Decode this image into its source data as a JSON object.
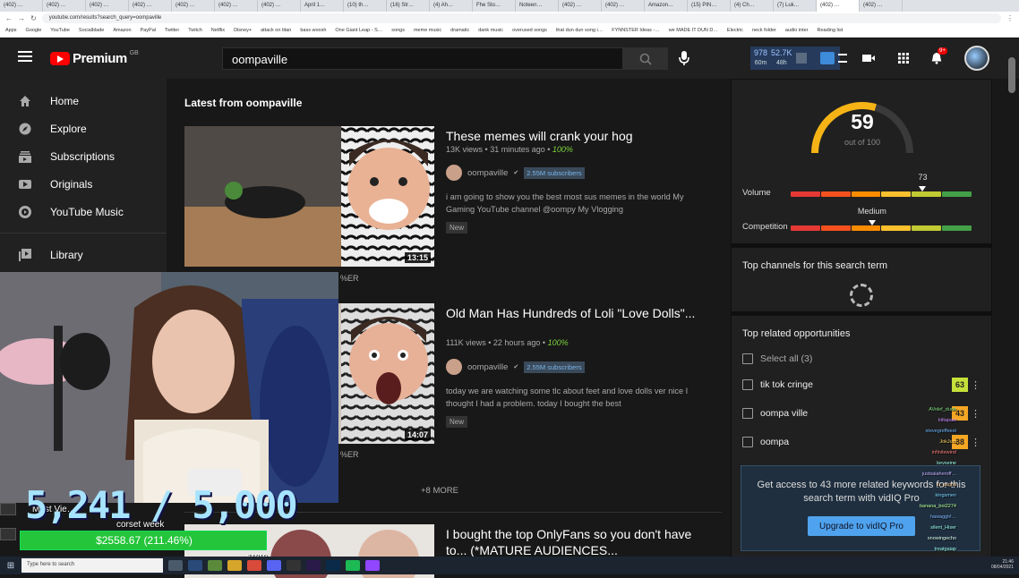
{
  "browser": {
    "tabs": [
      "(402) …",
      "(402) …",
      "(402) …",
      "(402) …",
      "(402) …",
      "(402) …",
      "(402) …",
      "April 1…",
      "(10) th…",
      "(16) Str…",
      "(4) Ah…",
      "Fhe Sto…",
      "Noteen…",
      "(402) …",
      "(402) …",
      "Amazon…",
      "(15) PIN…",
      "(4) Ch…",
      "(7) Luk…",
      "(402) …",
      "(402) …"
    ],
    "url": "youtube.com/results?search_query=oompaville",
    "bookmarks": [
      "Apps",
      "Google",
      "YouTube",
      "Socialblade",
      "Amazon",
      "PayPal",
      "Twitter",
      "Twitch",
      "Netflix",
      "Disney+",
      "attack on titan",
      "bass woosh",
      "One Giant Leap - S…",
      "songs",
      "meme music",
      "dramatic",
      "dank music",
      "overused songs",
      "that dun dun song i…",
      "FYNNSTER Ideas -…",
      "we MADE IT DUN D…",
      "Electric",
      "neck folder",
      "audio inter",
      "Reading list"
    ]
  },
  "header": {
    "logo_text": "Premium",
    "logo_sup": "GB",
    "search_value": "oompaville",
    "stats": [
      {
        "value": "978",
        "label": "60m"
      },
      {
        "value": "52.7K",
        "label": "48h"
      }
    ],
    "notif_count": "9+"
  },
  "sidebar": {
    "items": [
      {
        "label": "Home",
        "icon": "home-icon"
      },
      {
        "label": "Explore",
        "icon": "compass-icon"
      },
      {
        "label": "Subscriptions",
        "icon": "subscriptions-icon"
      },
      {
        "label": "Originals",
        "icon": "originals-icon"
      },
      {
        "label": "YouTube Music",
        "icon": "music-icon"
      },
      {
        "label": "Library",
        "icon": "library-icon"
      }
    ]
  },
  "main": {
    "section_title": "Latest from oompaville",
    "videos": [
      {
        "title": "These memes will crank your hog",
        "views": "13K views",
        "age": "31 minutes ago",
        "pct": "100%",
        "channel": "oompaville",
        "subs": "2.55M subscribers",
        "desc": "i am going to show you the best most sus memes in the world My Gaming YouTube channel @oompy My Vlogging",
        "badge": "New",
        "duration": "13:15",
        "tag": "%ER"
      },
      {
        "title": "Old Man Has Hundreds of Loli \"Love Dolls\"...",
        "views": "111K views",
        "age": "22 hours ago",
        "pct": "100%",
        "channel": "oompaville",
        "subs": "2.55M subscribers",
        "desc": "today we are watching some tlc about feet and love dolls ver nice I thought I had a problem. today I bought the best",
        "badge": "New",
        "duration": "14:07",
        "tag": "%ER"
      },
      {
        "title": "I bought the top OnlyFans so you don't have to... (*MATURE AUDIENCES..."
      }
    ],
    "more": "+8 MORE"
  },
  "vidiq": {
    "score": "59",
    "out_of": "out of 100",
    "score_level": 59,
    "volume_label": "Volume",
    "volume_value": "73",
    "volume_level": 73,
    "competition_label": "Competition",
    "competition_value": "Medium",
    "competition_level": 45,
    "top_channels_title": "Top channels for this search term",
    "opps_title": "Top related opportunities",
    "select_all": "Select all (3)",
    "opps": [
      {
        "term": "tik tok cringe",
        "score": "63",
        "color": "#c6e03a"
      },
      {
        "term": "oompa ville",
        "score": "43",
        "color": "#f5a623"
      },
      {
        "term": "oompa",
        "score": "38",
        "color": "#f5a623"
      }
    ],
    "cta_text": "Get access to 43 more related keywords for this search term with vidIQ Pro",
    "cta_button": "Upgrade to vidIQ Pro"
  },
  "stream": {
    "counter": "5,241 / 5,000",
    "goal_title": "corset week",
    "goal_amount": "$2558.67 (211.46%)",
    "goal_level": 100,
    "mini_label": "Most Vie…",
    "chat": [
      "AVolef_dude",
      "kittapaw",
      "stevegreffeest",
      "JokJust",
      "infinitewind",
      "kevseine",
      "justsaiaheroff…",
      "lu_sagna",
      "kingsmen",
      "banana_boi2274",
      "hawaggirl…",
      "silent_Hiser",
      "snowingecho",
      "treatgaiap"
    ],
    "tag_amount": "$1210"
  },
  "taskbar": {
    "search_placeholder": "Type here to search",
    "time": "21:46",
    "date": "08/04/2021"
  }
}
